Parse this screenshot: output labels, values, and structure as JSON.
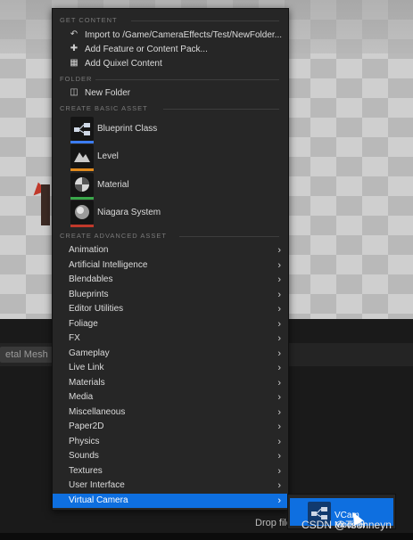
{
  "background": {
    "mesh_button": "etal Mesh",
    "drop_hint": "Drop file",
    "watermark": "CSDN @Tsohneyn"
  },
  "menu": {
    "sections": {
      "get_content": "GET CONTENT",
      "folder": "FOLDER",
      "basic": "CREATE BASIC ASSET",
      "advanced": "CREATE ADVANCED ASSET"
    },
    "get_content_items": [
      {
        "label": "Import to /Game/CameraEffects/Test/NewFolder...",
        "icon": "import-icon"
      },
      {
        "label": "Add Feature or Content Pack...",
        "icon": "add-feature-icon"
      },
      {
        "label": "Add Quixel Content",
        "icon": "quixel-icon"
      }
    ],
    "folder_item": {
      "label": "New Folder",
      "icon": "folder-icon"
    },
    "basic_assets": [
      {
        "label": "Blueprint Class",
        "icon": "blueprint-class-icon",
        "color": "#3c7cf0"
      },
      {
        "label": "Level",
        "icon": "level-icon",
        "color": "#e08a1e"
      },
      {
        "label": "Material",
        "icon": "material-icon",
        "color": "#3aa84a"
      },
      {
        "label": "Niagara System",
        "icon": "niagara-system-icon",
        "color": "#c0392b"
      }
    ],
    "advanced_assets": [
      "Animation",
      "Artificial Intelligence",
      "Blendables",
      "Blueprints",
      "Editor Utilities",
      "Foliage",
      "FX",
      "Gameplay",
      "Live Link",
      "Materials",
      "Media",
      "Miscellaneous",
      "Paper2D",
      "Physics",
      "Sounds",
      "Textures",
      "User Interface",
      "Virtual Camera"
    ],
    "active_item": "Virtual Camera"
  },
  "submenu": {
    "item": {
      "label": "VCam Modifier",
      "icon": "vcam-modifier-icon"
    }
  },
  "colors": {
    "accent": "#0e6fe0",
    "menu_bg": "#262626"
  }
}
